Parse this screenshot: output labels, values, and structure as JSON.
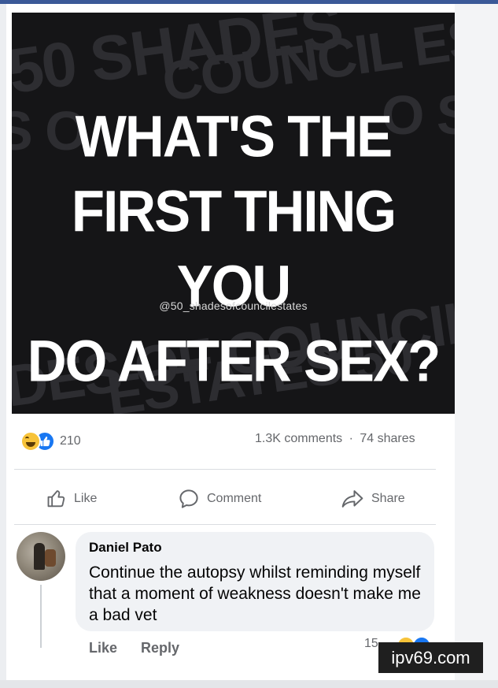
{
  "meme": {
    "headline_lines": [
      "WHAT'S THE",
      "FIRST THING YOU",
      "DO AFTER SEX?"
    ],
    "handle": "@50_shadesofcouncilestates"
  },
  "reactions": {
    "types": [
      "haha",
      "like"
    ],
    "count": "210"
  },
  "stats": {
    "comments": "1.3K comments",
    "separator": "·",
    "shares": "74 shares"
  },
  "actions": {
    "like": "Like",
    "comment": "Comment",
    "share": "Share"
  },
  "comment": {
    "author": "Daniel Pato",
    "text": "Continue the autopsy whilst reminding myself that a moment of weakness doesn't make me a bad vet",
    "like": "Like",
    "reply": "Reply",
    "reaction_count": "15"
  },
  "watermark": "ipv69.com",
  "colors": {
    "facebook_blue": "#1877f2",
    "text_secondary": "#65676b",
    "comment_bubble": "#f0f2f5"
  }
}
